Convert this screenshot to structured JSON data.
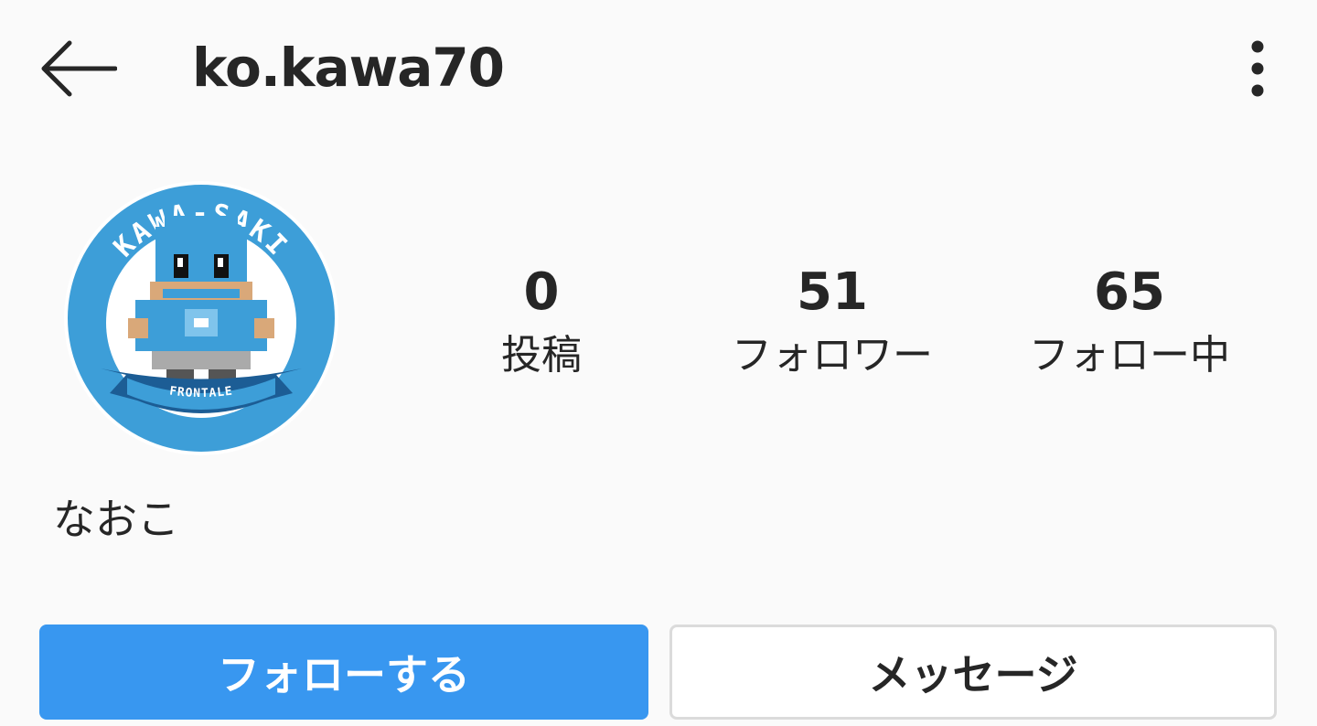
{
  "header": {
    "username": "ko.kawa70",
    "back_icon": "arrow-left-icon",
    "more_icon": "more-vertical-icon"
  },
  "profile": {
    "avatar": {
      "description_icon": "avatar-mascot-icon",
      "ring_text": "KAWA-SAKI",
      "banner_text": "FRONTALE"
    },
    "full_name": "なおこ",
    "stats": {
      "posts": {
        "count": "0",
        "label": "投稿"
      },
      "followers": {
        "count": "51",
        "label": "フォロワー"
      },
      "following": {
        "count": "65",
        "label": "フォロー中"
      }
    }
  },
  "actions": {
    "follow_label": "フォローする",
    "message_label": "メッセージ"
  },
  "colors": {
    "background": "#fafafa",
    "primary_button": "#3897f0",
    "text": "#262626",
    "border": "#dbdbdb",
    "avatar_blue": "#3d9ed8"
  }
}
